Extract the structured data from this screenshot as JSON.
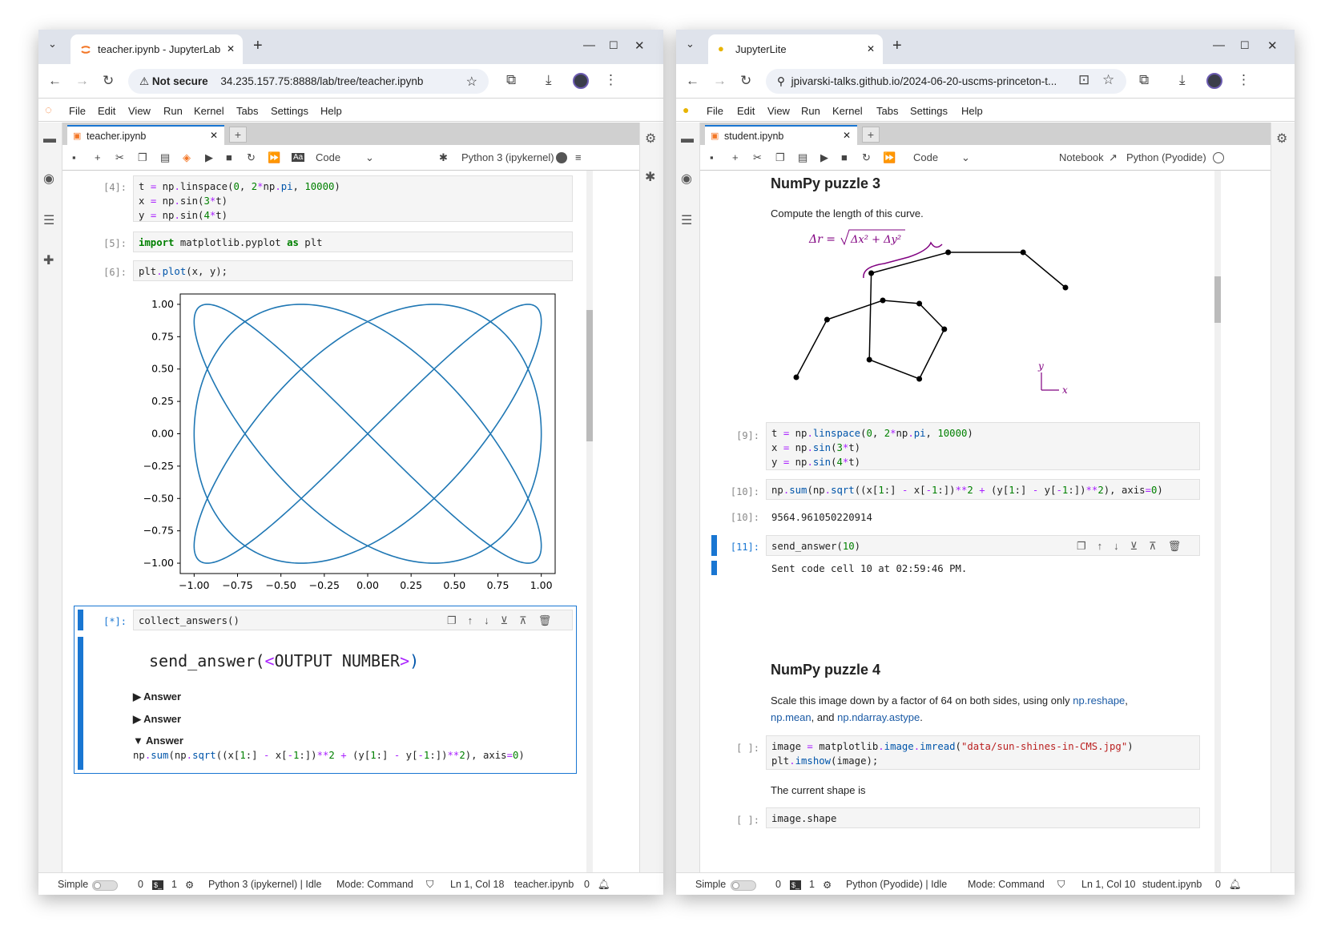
{
  "left": {
    "browser_tab_title": "teacher.ipynb - JupyterLab",
    "security_label": "Not secure",
    "url": "34.235.157.75:8888/lab/tree/teacher.ipynb",
    "menu": [
      "File",
      "Edit",
      "View",
      "Run",
      "Kernel",
      "Tabs",
      "Settings",
      "Help"
    ],
    "nb_tab": "teacher.ipynb",
    "cell_type": "Code",
    "kernel": "Python 3 (ipykernel)",
    "cells": {
      "c4_prompt": "[4]:",
      "c5_prompt": "[5]:",
      "c6_prompt": "[6]:",
      "c6_code": "plt.plot(x, y);",
      "cstar_prompt": "[*]:",
      "cstar_code": "collect_answers()",
      "send_fn": "send_answer(",
      "send_lt": "<",
      "send_mid": "OUTPUT NUMBER",
      "send_gt": ">",
      "send_close": ")",
      "answers": [
        "Answer",
        "Answer",
        "Answer"
      ],
      "answer_markers": [
        "▶",
        "▶",
        "▼"
      ]
    },
    "status": {
      "mode_label": "Simple",
      "num0": "0",
      "num1": "1",
      "kernel": "Python 3 (ipykernel) | Idle",
      "mode": "Mode: Command",
      "pos": "Ln 1, Col 18",
      "file": "teacher.ipynb",
      "notif": "0"
    }
  },
  "right": {
    "browser_tab_title": "JupyterLite",
    "url": "jpivarski-talks.github.io/2024-06-20-uscms-princeton-t...",
    "menu": [
      "File",
      "Edit",
      "View",
      "Run",
      "Kernel",
      "Tabs",
      "Settings",
      "Help"
    ],
    "nb_tab": "student.ipynb",
    "cell_type": "Code",
    "notebook_link": "Notebook",
    "kernel": "Python (Pyodide)",
    "puzzle3_title": "NumPy puzzle 3",
    "puzzle3_text": "Compute the length of this curve.",
    "formula_lhs": "Δr = ",
    "formula_radicand": "Δx² + Δy²",
    "axis_x": "x",
    "axis_y": "y",
    "c9_prompt": "[9]:",
    "c10_prompt": "[10]:",
    "out10_prompt": "[10]:",
    "out10": "9564.961050220914",
    "c11_prompt": "[11]:",
    "out11": "Sent code cell 10 at 02:59:46 PM.",
    "puzzle4_title": "NumPy puzzle 4",
    "puzzle4_text1": "Scale this image down by a factor of 64 on both sides, using only ",
    "puzzle4_link1": "np.reshape",
    "puzzle4_link2": "np.mean",
    "puzzle4_and": ", and ",
    "puzzle4_link3": "np.ndarray.astype",
    "puzzle4_end": ".",
    "blank_prompt": "[ ]:",
    "shape_text": "The current shape is",
    "cut_prompt": "[ ]:",
    "cut_code": "image.shape",
    "status": {
      "mode_label": "Simple",
      "num0": "0",
      "num1": "1",
      "kernel": "Python (Pyodide) | Idle",
      "mode": "Mode: Command",
      "pos": "Ln 1, Col 10",
      "file": "student.ipynb",
      "notif": "0"
    }
  },
  "chart_data": [
    {
      "type": "line",
      "series": [
        {
          "expr": "x = sin(3t), y = sin(4t)",
          "t_range": [
            0,
            6.283185307179586
          ],
          "samples": 10000
        }
      ],
      "xlim": [
        -1.08,
        1.08
      ],
      "ylim": [
        -1.08,
        1.08
      ],
      "xticks": [
        "−1.00",
        "−0.75",
        "−0.50",
        "−0.25",
        "0.00",
        "0.25",
        "0.50",
        "0.75",
        "1.00"
      ],
      "yticks": [
        "1.00",
        "0.75",
        "0.50",
        "0.25",
        "0.00",
        "−0.25",
        "−0.50",
        "−0.75",
        "−1.00"
      ],
      "color": "#1f77b4",
      "grid": false
    },
    {
      "type": "diagram",
      "points": [
        [
          0.05,
          0.1
        ],
        [
          0.21,
          0.46
        ],
        [
          0.5,
          0.58
        ],
        [
          0.69,
          0.56
        ],
        [
          0.82,
          0.4
        ],
        [
          0.69,
          0.09
        ],
        [
          0.43,
          0.21
        ],
        [
          0.44,
          0.75
        ],
        [
          0.84,
          0.88
        ],
        [
          1.23,
          0.88
        ],
        [
          1.45,
          0.66
        ]
      ]
    }
  ],
  "colors": {
    "accent": "#1976d2",
    "plot_line": "#1f77b4",
    "formula": "#800080",
    "link": "#1a5aa5"
  }
}
